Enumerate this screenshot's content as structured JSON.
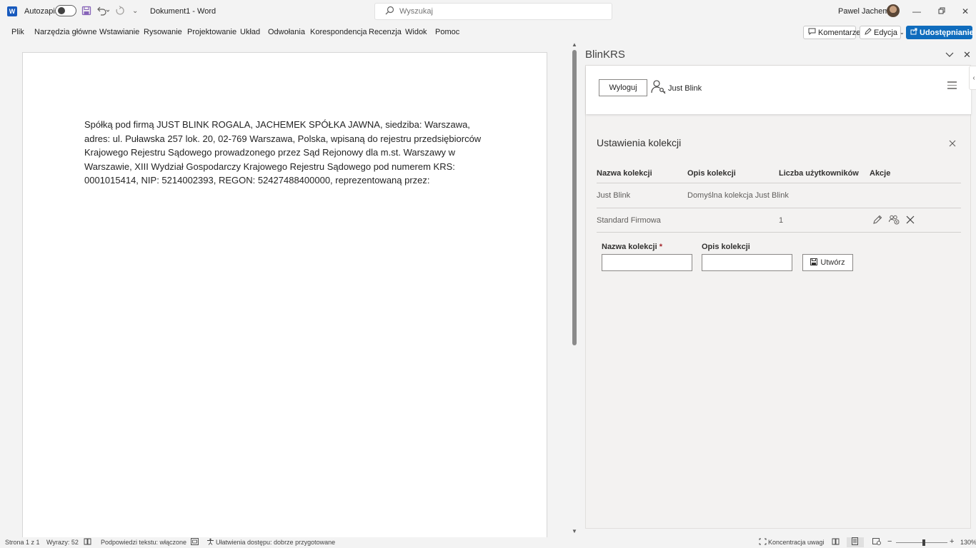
{
  "titlebar": {
    "autosave_label": "Autozapis",
    "doc_title": "Dokument1  -  Word",
    "search_placeholder": "Wyszukaj",
    "user_name": "Pawel Jachemek",
    "app_icon_letter": "W"
  },
  "ribbon": {
    "tabs": [
      "Plik",
      "Narzędzia główne",
      "Wstawianie",
      "Rysowanie",
      "Projektowanie",
      "Układ",
      "Odwołania",
      "Korespondencja",
      "Recenzja",
      "Widok",
      "Pomoc"
    ],
    "comments_label": "Komentarze",
    "editing_label": "Edycja",
    "share_label": "Udostępnianie"
  },
  "document": {
    "paragraph": "Spółką pod firmą JUST BLINK ROGALA, JACHEMEK SPÓŁKA JAWNA, siedziba: Warszawa, adres: ul. Puławska 257 lok. 20, 02-769 Warszawa, Polska, wpisaną do rejestru przedsiębiorców Krajowego Rejestru Sądowego prowadzonego przez Sąd Rejonowy dla m.st. Warszawy w Warszawie, XIII Wydział Gospodarczy Krajowego Rejestru Sądowego pod numerem KRS: 0001015414, NIP: 5214002393, REGON: 52427488400000, reprezentowaną przez:"
  },
  "pane": {
    "title": "BlinKRS",
    "logout_label": "Wyloguj",
    "account_name": "Just Blink",
    "settings_title": "Ustawienia kolekcji",
    "table": {
      "headers": [
        "Nazwa kolekcji",
        "Opis kolekcji",
        "Liczba użytkowników",
        "Akcje"
      ],
      "rows": [
        {
          "name": "Just Blink",
          "description": "Domyślna kolekcja Just Blink",
          "users": ""
        },
        {
          "name": "Standard Firmowa",
          "description": "",
          "users": "1"
        }
      ]
    },
    "form": {
      "name_label": "Nazwa kolekcji",
      "required_mark": "*",
      "description_label": "Opis kolekcji",
      "create_label": "Utwórz"
    }
  },
  "statusbar": {
    "page": "Strona 1 z 1",
    "words": "Wyrazy: 52",
    "predictions": "Podpowiedzi tekstu: włączone",
    "accessibility": "Ułatwienia dostępu: dobrze przygotowane",
    "focus": "Koncentracja uwagi",
    "zoom_minus": "−",
    "zoom_plus": "+",
    "zoom_level": "130%"
  },
  "colors": {
    "accent": "#0f6cbd",
    "word_blue": "#185abd",
    "required": "#a4262c"
  }
}
